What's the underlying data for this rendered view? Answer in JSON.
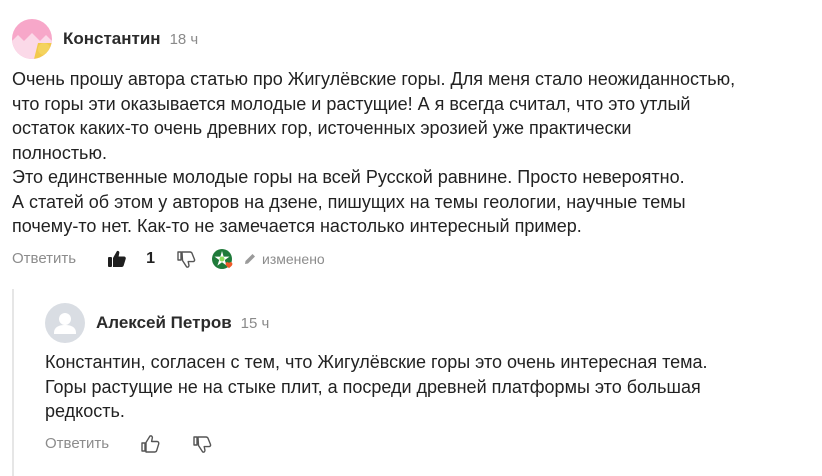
{
  "comments": [
    {
      "author": "Константин",
      "time": "18 ч",
      "text": "Очень прошу автора статью про Жигулёвские горы. Для меня стало неожиданностью,\nчто горы эти оказывается молодые и растущие! А я всегда считал, что это утлый\nостаток каких-то очень древних гор, источенных эрозией уже практически\nполностью.\nЭто единственные молодые горы на всей Русской равнине. Просто невероятно.\nА статей об этом у авторов на дзене, пишущих на темы геологии, научные темы\nпочему-то нет. Как-то не замечается настолько интересный пример.",
      "reply_label": "Ответить",
      "like_count": "1",
      "edited_label": "изменено",
      "avatar_colors": [
        "#f7a7c9",
        "#f2c94c"
      ]
    },
    {
      "author": "Алексей Петров",
      "time": "15 ч",
      "text": "Константин, согласен с тем, что Жигулёвские горы это очень интересная тема.\nГоры растущие не на стыке плит, а посреди древней платформы это большая\nредкость.",
      "reply_label": "Ответить"
    }
  ],
  "colors": {
    "muted": "#8c8c8c",
    "text": "#222222",
    "reply_line": "#e6e6e6"
  },
  "icons": {
    "like": "thumbs-up-icon",
    "dislike": "thumbs-down-icon",
    "edit": "pencil-icon",
    "badge": "green-star-badge-icon",
    "default_avatar": "user-silhouette-icon"
  }
}
